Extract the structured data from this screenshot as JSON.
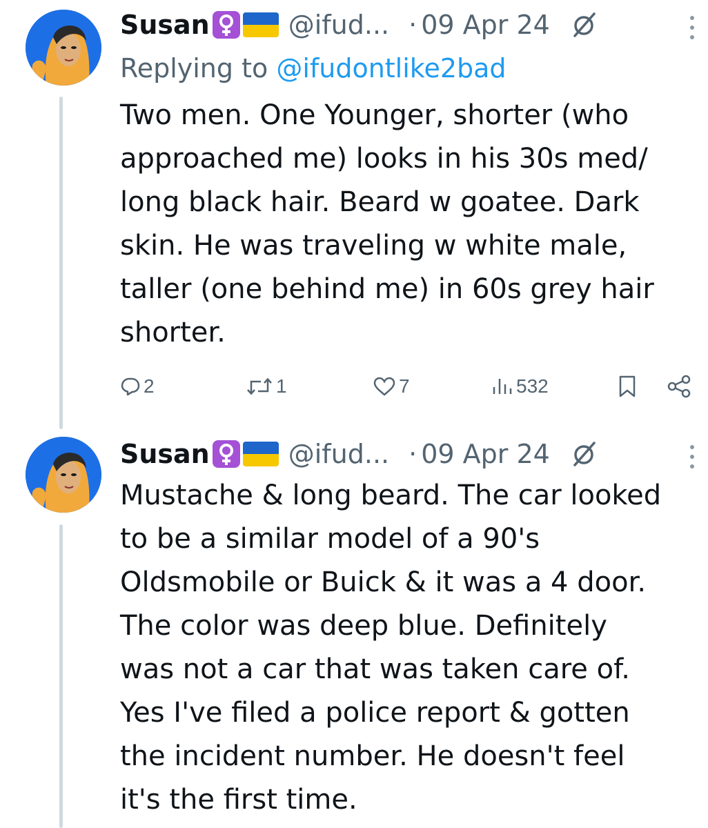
{
  "tweets": [
    {
      "author_name": "Susan",
      "handle": "@ifud...",
      "separator": "·",
      "date": "09 Apr 24",
      "reply_prefix": "Replying to ",
      "reply_handle": "@ifudontlike2bad",
      "text": "Two men. One Younger, shorter (who\napproached me) looks in his 30s med/\nlong black hair. Beard w goatee. Dark\nskin. He was traveling w white male,\ntaller (one behind me) in 60s grey hair\nshorter.",
      "replies": "2",
      "retweets": "1",
      "likes": "7",
      "views": "532"
    },
    {
      "author_name": "Susan",
      "handle": "@ifud...",
      "separator": "·",
      "date": "09 Apr 24",
      "text": "Mustache & long beard. The car looked\nto be a similar model of a 90's\nOldsmobile or Buick & it was a 4 door.\nThe color was deep blue. Definitely\nwas not a car that was taken care of.\nYes I've filed a police report & gotten\nthe incident number. He doesn't feel\nit's the first time."
    }
  ],
  "colors": {
    "text_primary": "#0f1419",
    "text_secondary": "#536471",
    "link": "#1d9bf0",
    "thread_line": "#cfd9de",
    "emoji_bg": "#a451d6",
    "flag_blue": "#1e66c9",
    "flag_yellow": "#f7c800"
  },
  "icons": {
    "female_sign": "female-sign-icon",
    "flag": "ukraine-flag-icon",
    "grok": "grok-icon",
    "more": "more-vertical-icon",
    "reply": "reply-icon",
    "retweet": "retweet-icon",
    "like": "heart-icon",
    "views": "views-bar-icon",
    "bookmark": "bookmark-icon",
    "share": "share-icon"
  }
}
